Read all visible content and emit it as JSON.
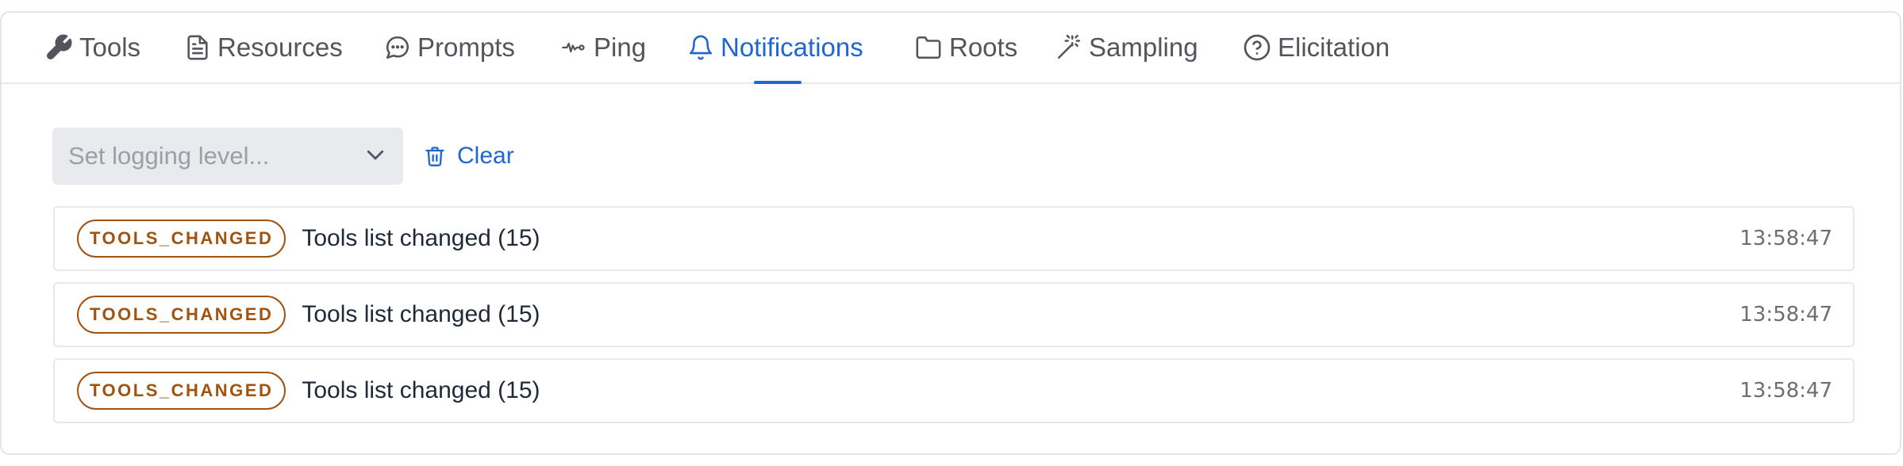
{
  "tabs": [
    {
      "label": "Tools",
      "icon": "wrench-icon",
      "active": false
    },
    {
      "label": "Resources",
      "icon": "file-icon",
      "active": false
    },
    {
      "label": "Prompts",
      "icon": "chat-bubble-icon",
      "active": false
    },
    {
      "label": "Ping",
      "icon": "activity-icon",
      "active": false
    },
    {
      "label": "Notifications",
      "icon": "bell-icon",
      "active": true
    },
    {
      "label": "Roots",
      "icon": "folder-icon",
      "active": false
    },
    {
      "label": "Sampling",
      "icon": "magic-wand-icon",
      "active": false
    },
    {
      "label": "Elicitation",
      "icon": "question-circle-icon",
      "active": false
    }
  ],
  "toolbar": {
    "logging_placeholder": "Set logging level...",
    "clear_label": "Clear"
  },
  "notifications": [
    {
      "type": "TOOLS_CHANGED",
      "message": "Tools list changed (15)",
      "time": "13:58:47"
    },
    {
      "type": "TOOLS_CHANGED",
      "message": "Tools list changed (15)",
      "time": "13:58:47"
    },
    {
      "type": "TOOLS_CHANGED",
      "message": "Tools list changed (15)",
      "time": "13:58:47"
    }
  ],
  "colors": {
    "accent": "#1e66d0",
    "badge": "#a0520f",
    "tab_text": "#52565c",
    "select_bg": "#e8eaed"
  }
}
